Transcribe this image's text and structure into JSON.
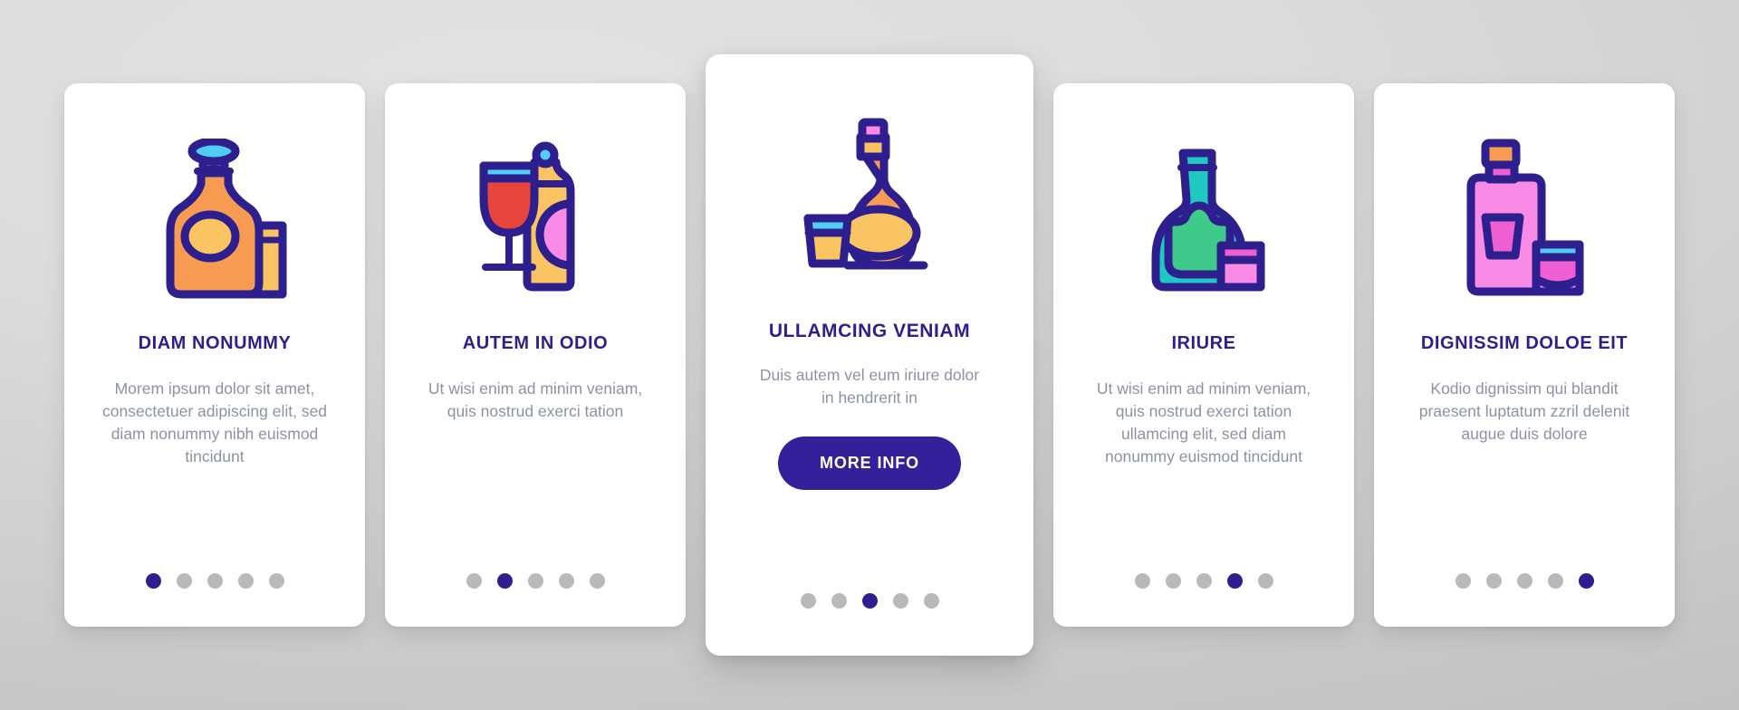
{
  "background": {
    "color_light": "#e2e2e2",
    "color_dark": "#bdbdbd"
  },
  "theme": {
    "title_color": "#2e1f8f",
    "body_color": "#8b93a3",
    "accent_color": "#34219a",
    "dot_inactive_color": "#b9b9b9",
    "card_background": "#ffffff"
  },
  "cards": [
    {
      "id": "card-1",
      "icon_name": "decanter-and-glass-icon",
      "title": "DIAM NONUMMY",
      "body": "Morem ipsum dolor sit amet, consectetuer adipiscing elit, sed diam nonummy nibh euismod tincidunt",
      "featured": false,
      "button_label": null,
      "dots": {
        "count": 5,
        "active_index": 0
      }
    },
    {
      "id": "card-2",
      "icon_name": "wine-glass-and-bottle-icon",
      "title": "AUTEM IN ODIO",
      "body": "Ut wisi enim ad minim veniam, quis nostrud exerci tation",
      "featured": false,
      "button_label": null,
      "dots": {
        "count": 5,
        "active_index": 1
      }
    },
    {
      "id": "card-3",
      "icon_name": "cognac-bottle-and-shot-icon",
      "title": "ULLAMCING VENIAM",
      "body": "Duis autem vel eum iriure dolor in hendrerit in",
      "featured": true,
      "button_label": "MORE INFO",
      "dots": {
        "count": 5,
        "active_index": 2
      }
    },
    {
      "id": "card-4",
      "icon_name": "teal-bottle-and-glass-icon",
      "title": "IRIURE",
      "body": "Ut wisi enim ad minim veniam, quis nostrud exerci tation ullamcing elit, sed diam nonummy euismod tincidunt",
      "featured": false,
      "button_label": null,
      "dots": {
        "count": 5,
        "active_index": 3
      }
    },
    {
      "id": "card-5",
      "icon_name": "pink-bottle-and-shot-glass-icon",
      "title": "DIGNISSIM DOLOE EIT",
      "body": "Kodio dignissim qui blandit praesent luptatum zzril delenit augue duis dolore",
      "featured": false,
      "button_label": null,
      "dots": {
        "count": 5,
        "active_index": 4
      }
    }
  ],
  "icon_palette": {
    "stroke": "#2e1f8f",
    "orange": "#f89b52",
    "orange_light": "#fbc463",
    "yellow": "#fbc463",
    "cyan": "#4fcdf2",
    "red": "#e8453c",
    "pink": "#f98ae6",
    "magenta": "#ef5fd2",
    "teal": "#1fc8c1",
    "green": "#3fc98a"
  }
}
